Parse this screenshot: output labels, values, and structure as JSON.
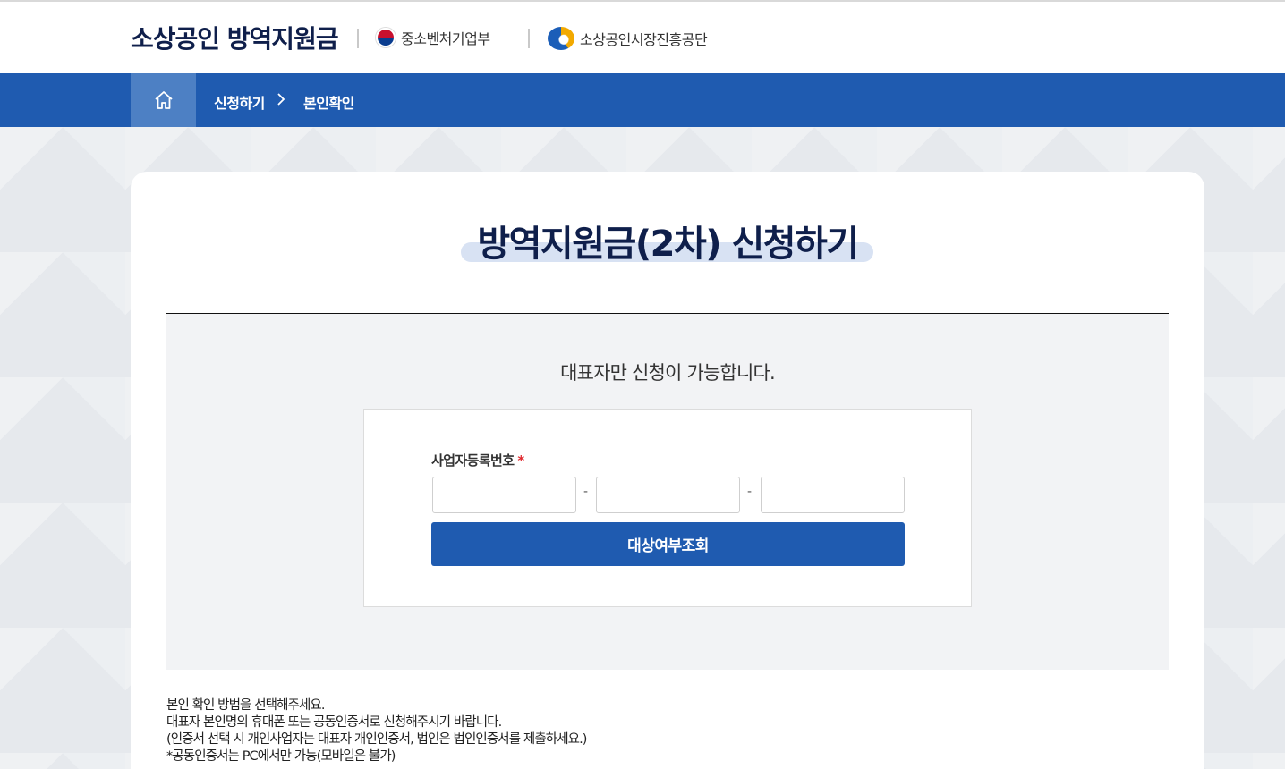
{
  "header": {
    "site_title": "소상공인 방역지원금",
    "org1": {
      "name": "중소벤처기업부",
      "icon": "taegeuk-emblem-icon"
    },
    "org2": {
      "name": "소상공인시장진흥공단",
      "icon": "semas-logo-icon"
    }
  },
  "nav": {
    "home_icon": "home-icon",
    "crumbs": [
      "신청하기",
      "본인확인"
    ],
    "separator_icon": "chevron-right-icon"
  },
  "main": {
    "page_title": "방역지원금(2차) 신청하기",
    "notice": "대표자만 신청이 가능합니다.",
    "form": {
      "label": "사업자등록번호",
      "required_mark": "*",
      "part1_value": "",
      "part2_value": "",
      "part3_value": "",
      "separator": "-",
      "submit_label": "대상여부조회"
    },
    "guide_lines": [
      "본인 확인 방법을 선택해주세요.",
      "대표자 본인명의 휴대폰 또는 공동인증서로 신청해주시기 바랍니다.",
      "(인증서 선택 시 개인사업자는 대표자 개인인증서, 법인은 법인인증서를 제출하세요.)",
      "*공동인증서는 PC에서만 가능(모바일은 불가)"
    ]
  },
  "colors": {
    "primary": "#1f5bb0",
    "title_navy": "#0f1f4b",
    "required_red": "#e0282e"
  }
}
